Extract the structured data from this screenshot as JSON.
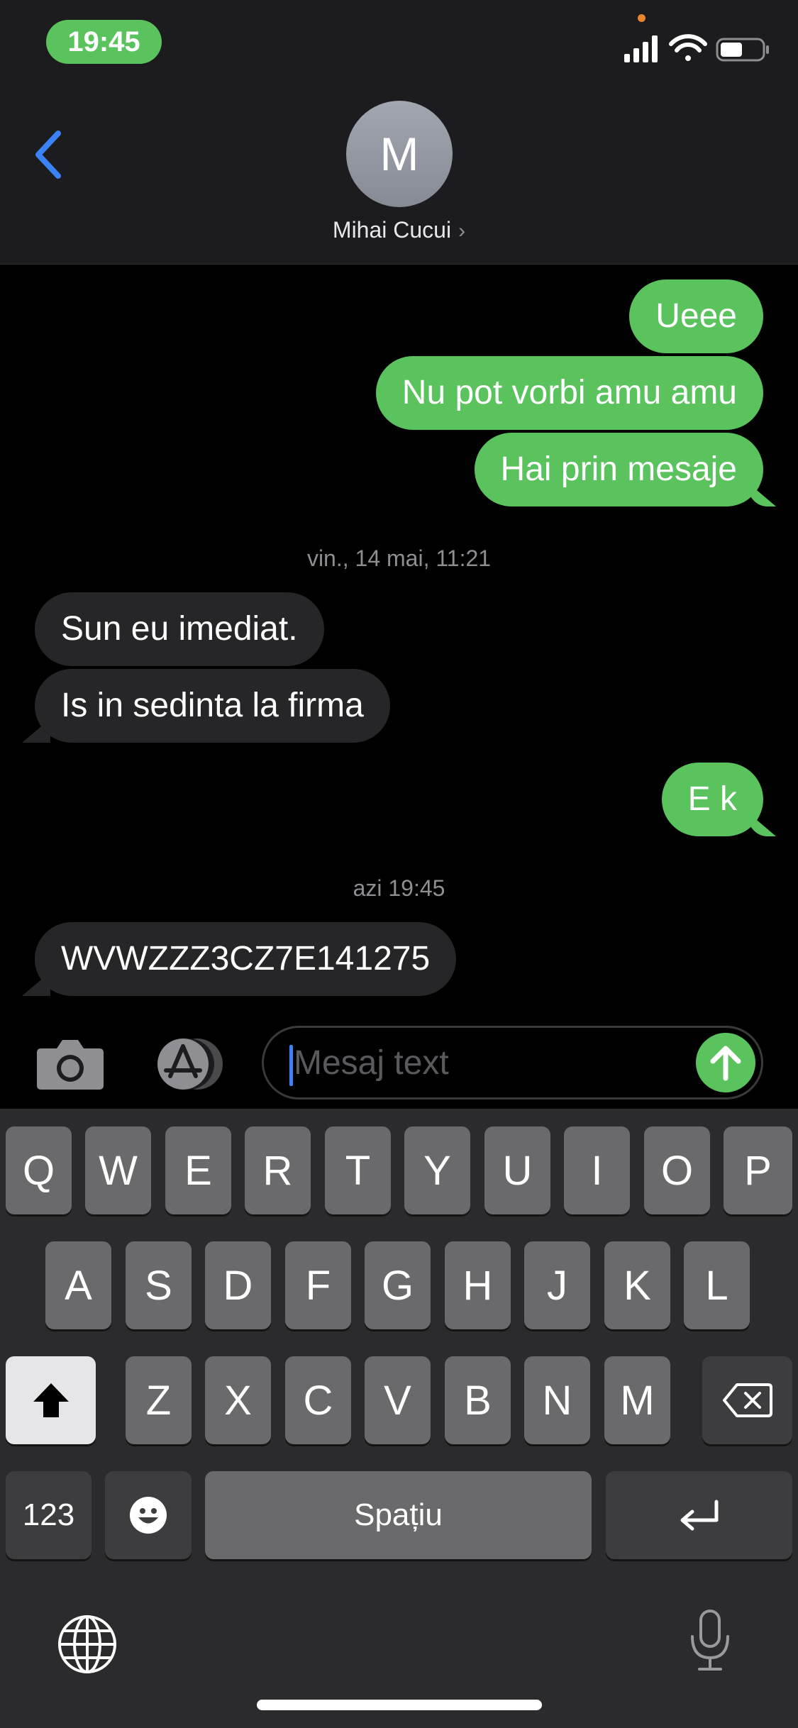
{
  "status_bar": {
    "time": "19:45"
  },
  "header": {
    "avatar_initial": "M",
    "contact_name": "Mihai Cucui"
  },
  "messages_group1": [
    {
      "text": "Ueee",
      "direction": "outgoing"
    },
    {
      "text": "Nu pot vorbi amu amu",
      "direction": "outgoing"
    },
    {
      "text": "Hai prin mesaje",
      "direction": "outgoing"
    }
  ],
  "timestamp1": "vin., 14 mai, 11:21",
  "messages_group2": [
    {
      "text": "Sun eu imediat.",
      "direction": "incoming"
    },
    {
      "text": "Is in sedinta la firma",
      "direction": "incoming"
    }
  ],
  "messages_group3": [
    {
      "text": "E k",
      "direction": "outgoing"
    }
  ],
  "timestamp2": "azi 19:45",
  "messages_group4": [
    {
      "text": "WVWZZZ3CZ7E141275",
      "direction": "incoming"
    }
  ],
  "composer": {
    "placeholder": "Mesaj text"
  },
  "keyboard": {
    "row1": [
      "Q",
      "W",
      "E",
      "R",
      "T",
      "Y",
      "U",
      "I",
      "O",
      "P"
    ],
    "row2": [
      "A",
      "S",
      "D",
      "F",
      "G",
      "H",
      "J",
      "K",
      "L"
    ],
    "row3": [
      "Z",
      "X",
      "C",
      "V",
      "B",
      "N",
      "M"
    ],
    "numbers_label": "123",
    "space_label": "Spațiu"
  },
  "colors": {
    "outgoing_bubble": "#5ac35e",
    "incoming_bubble": "#262628",
    "accent_blue": "#3b82f6"
  }
}
